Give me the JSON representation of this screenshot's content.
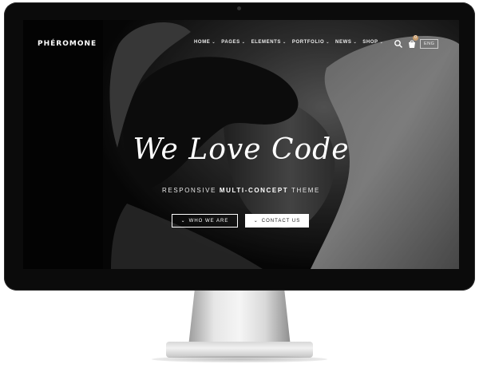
{
  "brand": {
    "name": "PHÉROMONE"
  },
  "nav": {
    "items": [
      {
        "label": "HOME"
      },
      {
        "label": "PAGES"
      },
      {
        "label": "ELEMENTS"
      },
      {
        "label": "PORTFOLIO"
      },
      {
        "label": "NEWS"
      },
      {
        "label": "SHOP"
      }
    ],
    "cart_count": "0",
    "language": "ENG"
  },
  "hero": {
    "title": "We Love Code",
    "tagline_prefix": "RESPONSIVE ",
    "tagline_bold": "MULTI-CONCEPT",
    "tagline_suffix": " THEME",
    "btn_primary": "WHO WE ARE",
    "btn_secondary": "CONTACT US"
  },
  "icons": {
    "search": "search-icon",
    "cart": "cart-icon",
    "chevron": "chevron-down-icon"
  },
  "colors": {
    "screen_bg": "#050505",
    "bezel": "#0b0b0b",
    "cart_badge": "#c89c6a"
  }
}
